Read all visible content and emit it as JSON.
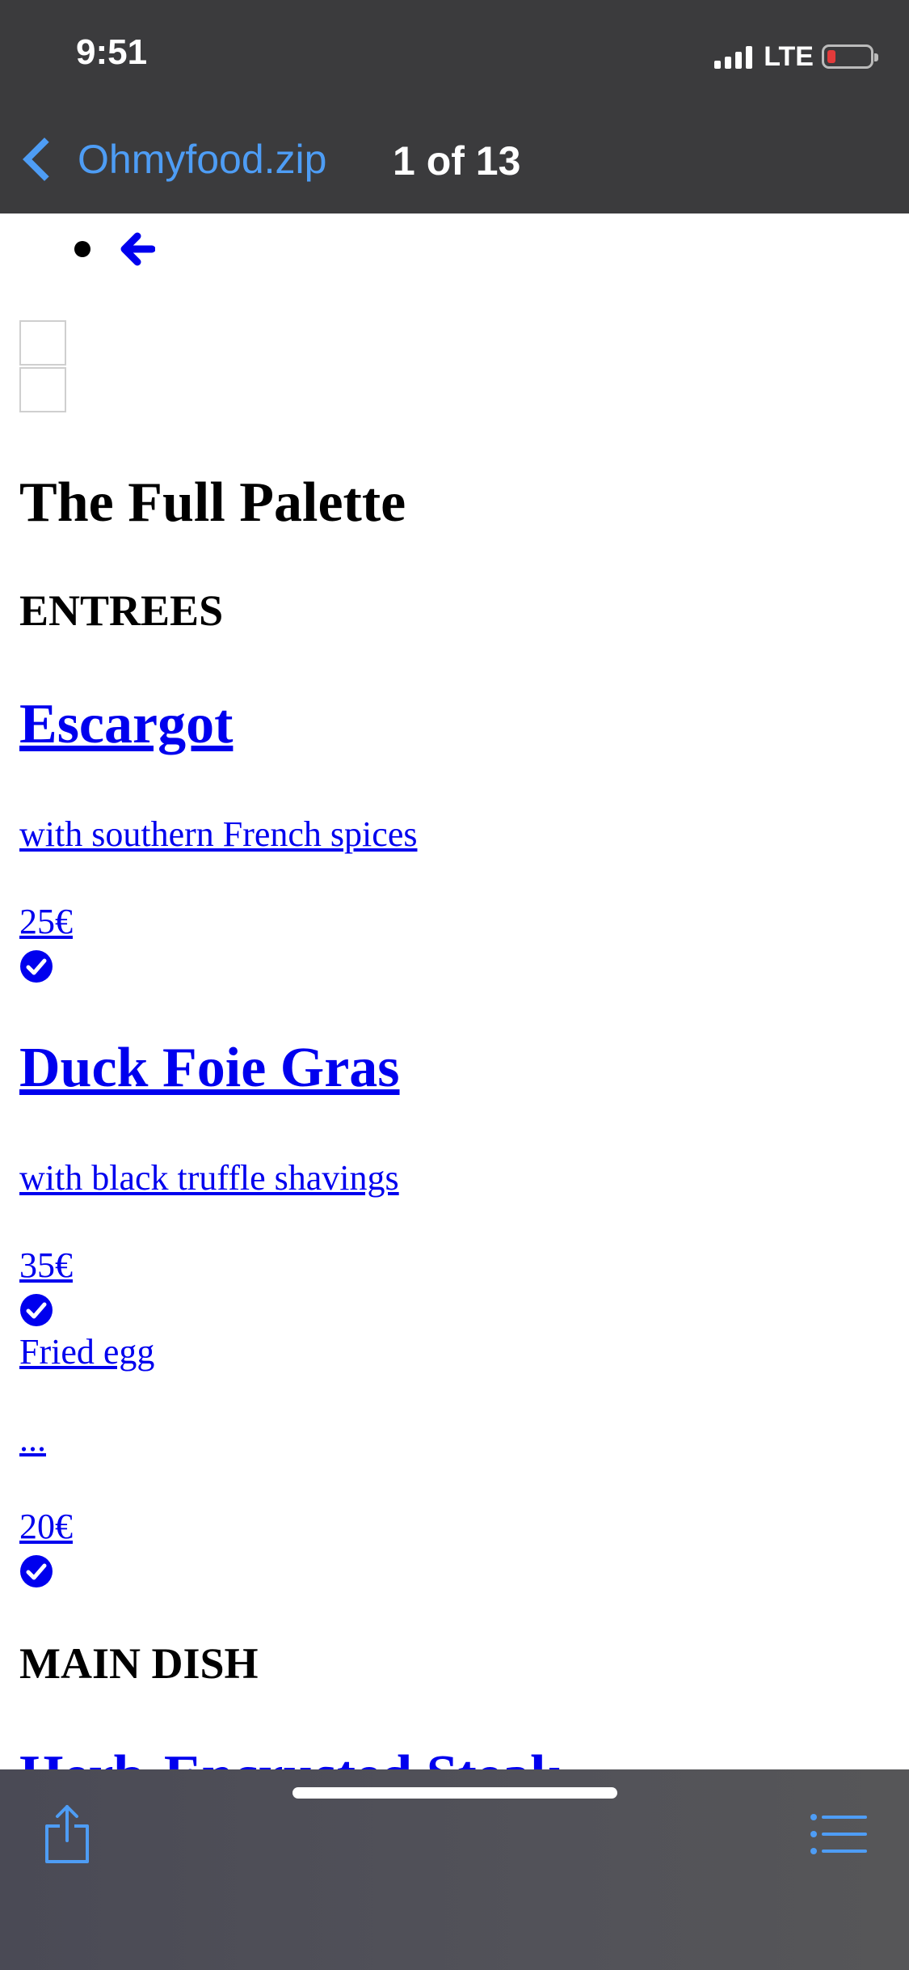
{
  "status_bar": {
    "time": "9:51",
    "network": "LTE",
    "battery_level_percent": 10
  },
  "nav": {
    "back_label": "Ohmyfood.zip",
    "title": "1 of 13"
  },
  "page": {
    "title": "The Full Palette",
    "sections": [
      {
        "heading": "ENTREES"
      },
      {
        "heading": "MAIN DISH"
      }
    ],
    "dishes": [
      {
        "name": "Escargot",
        "description": "with southern French spices",
        "price": "25€"
      },
      {
        "name": "Duck Foie Gras",
        "description": "with black truffle shavings",
        "price": "35€"
      },
      {
        "name": "Fried egg",
        "description": "...",
        "price": "20€"
      }
    ],
    "cut_off_dish_name": "Herb-Encrusted Steak"
  },
  "icons": {
    "back": "chevron-left-icon",
    "arrow": "arrow-left-icon",
    "check": "check-circle-icon",
    "share": "share-icon",
    "list": "list-icon"
  },
  "colors": {
    "link": "#0000ee",
    "ios_accent": "#4e9df5",
    "bar_bg": "#3b3b3d"
  }
}
